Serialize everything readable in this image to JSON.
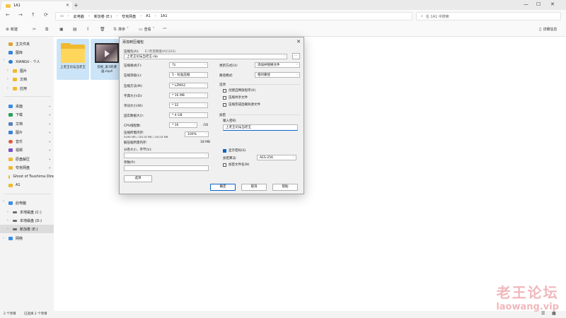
{
  "window": {
    "tab_title": "1A1",
    "new_tab": "+",
    "controls": {
      "minimize": "—",
      "maximize": "☐",
      "close": "✕"
    }
  },
  "nav": {
    "back": "←",
    "forward": "→",
    "up": "↑",
    "refresh": "⟳",
    "breadcrumb": [
      "此电脑",
      "新加卷 (E:)",
      "夸克网盘",
      "A1",
      "1A1"
    ],
    "breadcrumb_sep": "›",
    "search_placeholder": "在 1A1 中搜索"
  },
  "toolbar": {
    "new": "新建",
    "sort": "排序",
    "view": "查看",
    "more": "···",
    "details": "详细信息"
  },
  "sidebar": {
    "items": [
      {
        "label": "主文件夹"
      },
      {
        "label": "图库"
      },
      {
        "label": "XIANGU - 个人"
      },
      {
        "label": "图片"
      },
      {
        "label": "文档"
      },
      {
        "label": "应用"
      },
      {
        "label": "桌面"
      },
      {
        "label": "下载"
      },
      {
        "label": "文档"
      },
      {
        "label": "图片"
      },
      {
        "label": "音乐"
      },
      {
        "label": "视频"
      },
      {
        "label": "原盘解压"
      },
      {
        "label": "夸克网盘"
      },
      {
        "label": "Ghost of Tsushima Dire"
      },
      {
        "label": "A1"
      },
      {
        "label": "此电脑"
      },
      {
        "label": "本地磁盘 (C:)"
      },
      {
        "label": "本地磁盘 (D:)"
      },
      {
        "label": "新加卷 (E:)"
      },
      {
        "label": "网络"
      }
    ]
  },
  "files": [
    {
      "name": "上老王论坛当老王"
    },
    {
      "name": "双视_爱3的课画.mp4"
    }
  ],
  "statusbar": {
    "count": "2 个项目",
    "selected": "已选择 2 个项目"
  },
  "watermark": {
    "line1": "老王论坛",
    "line2": "laowang.vip"
  },
  "dialog": {
    "title": "添加到压缩包",
    "archive_label": "压缩包(A):",
    "archive_path": "E:\\夸克网盘\\A1\\1A1\\",
    "archive_name": "上老王论坛当老王.zip",
    "browse": "...",
    "format_label": "压缩格式(F):",
    "format_value": "7z",
    "level_label": "压缩等级(L):",
    "level_value": "5 - 标准压缩",
    "method_label": "压缩方法(M):",
    "method_value": "* LZMA2",
    "dict_label": "字典大小(D):",
    "dict_value": "* 16 MB",
    "word_label": "单词大小(W):",
    "word_value": "* 32",
    "solid_label": "固实数据大小:",
    "solid_value": "* 4 GB",
    "cpu_label": "CPU线程数:",
    "cpu_value": "* 16",
    "cpu_total": "/16",
    "mem_label": "压缩所需内存:",
    "mem_detail": "5496 MB / 16116 MB / 16116 MB",
    "mem_percent": "100%",
    "decomp_label": "解压缩所需内存:",
    "decomp_value": "18 MB",
    "split_label": "分卷大小，字节(V):",
    "params_label": "参数(P):",
    "options_button": "选项",
    "update_label": "更新方式(U):",
    "update_value": "添加并替换文件",
    "path_label": "路径模式:",
    "path_value": "相对路径",
    "options_title": "选项",
    "opt1": "创建自释放程序(X)",
    "opt2": "压缩共享文件",
    "opt3": "压缩完成后删除源文件",
    "encrypt_title": "加密",
    "password_label": "输入密码:",
    "password_value": "上老王论坛当老王",
    "show_password": "显示密码(S)",
    "enc_method_label": "加密算法:",
    "enc_method_value": "AES-256",
    "enc_names": "加密文件名(N)",
    "ok": "确定",
    "cancel": "取消",
    "help": "帮助"
  }
}
